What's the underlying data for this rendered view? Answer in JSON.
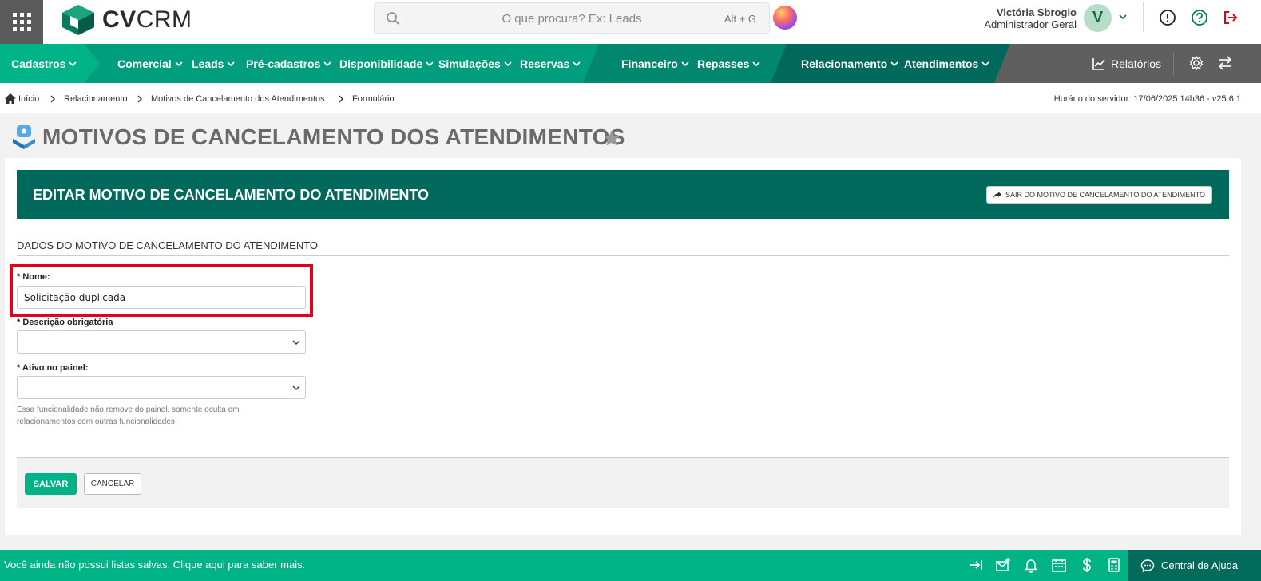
{
  "header": {
    "logo_bold": "CV",
    "logo_light": "CRM",
    "search_placeholder": "O que procura? Ex: Leads",
    "search_shortcut": "Alt + G",
    "user_name": "Victória Sbrogio",
    "user_role": "Administrador Geral",
    "avatar_initial": "V"
  },
  "nav": {
    "cadastros": "Cadastros",
    "comercial": "Comercial",
    "leads": "Leads",
    "pre_cadastros": "Pré-cadastros",
    "disponibilidade": "Disponibilidade",
    "simulacoes": "Simulações",
    "reservas": "Reservas",
    "financeiro": "Financeiro",
    "repasses": "Repasses",
    "relacionamento": "Relacionamento",
    "atendimentos": "Atendimentos",
    "relatorios": "Relatórios"
  },
  "breadcrumb": {
    "items": [
      "Início",
      "Relacionamento",
      "Motivos de Cancelamento dos Atendimentos",
      "Formulário"
    ],
    "server_time": "Horário do servidor: 17/06/2025 14h36 - v25.6.1"
  },
  "page": {
    "title": "MOTIVOS DE CANCELAMENTO DOS ATENDIMENTOS"
  },
  "form": {
    "header_title": "EDITAR MOTIVO DE CANCELAMENTO DO ATENDIMENTO",
    "exit_label": "SAIR DO MOTIVO DE CANCELAMENTO DO ATENDIMENTO",
    "section_title": "DADOS DO MOTIVO DE CANCELAMENTO DO ATENDIMENTO",
    "nome_label": "* Nome:",
    "nome_value": "Solicitação duplicada",
    "descricao_label": "* Descrição obrigatória",
    "ativo_label": "* Ativo no painel:",
    "help_text": "Essa funcionalidade não remove do painel, somente oculta em relacionamentos com outras funcionalidades",
    "save_label": "SALVAR",
    "cancel_label": "CANCELAR"
  },
  "bottom": {
    "message": "Você ainda não possui listas salvas. Clique aqui para saber mais.",
    "help_center": "Central de Ajuda"
  },
  "colors": {
    "nav_green_light": "#00b386",
    "nav_green_dark": "#00695c",
    "nav_gray": "#5f5f5f",
    "highlight_red": "#e3001b"
  }
}
